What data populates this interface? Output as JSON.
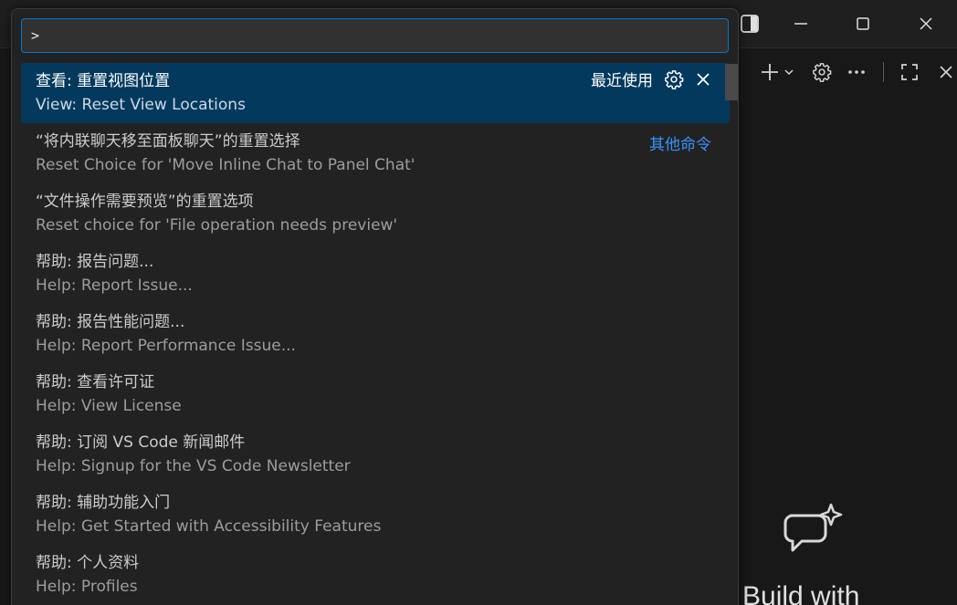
{
  "palette": {
    "input_value": ">",
    "items": [
      {
        "label": "查看: 重置视图位置",
        "detail": "View: Reset View Locations",
        "badge": "最近使用",
        "selected": true
      },
      {
        "label": "“将内联聊天移至面板聊天”的重置选择",
        "detail": "Reset Choice for 'Move Inline Chat to Panel Chat'",
        "group_label": "其他命令"
      },
      {
        "label": "“文件操作需要预览”的重置选项",
        "detail": "Reset choice for 'File operation needs preview'"
      },
      {
        "label": "帮助: 报告问题...",
        "detail": "Help: Report Issue..."
      },
      {
        "label": "帮助: 报告性能问题...",
        "detail": "Help: Report Performance Issue..."
      },
      {
        "label": "帮助: 查看许可证",
        "detail": "Help: View License"
      },
      {
        "label": "帮助: 订阅 VS Code 新闻邮件",
        "detail": "Help: Signup for the VS Code Newsletter"
      },
      {
        "label": "帮助: 辅助功能入门",
        "detail": "Help: Get Started with Accessibility Features"
      },
      {
        "label": "帮助: 个人资料",
        "detail": "Help: Profiles"
      }
    ]
  },
  "chat": {
    "welcome_title": "Build with"
  },
  "icons": {
    "settings": "gear-icon",
    "close": "close-icon",
    "add": "plus-icon",
    "more": "ellipsis-icon",
    "maximize": "maximize-icon",
    "chat": "chat-sparkle-icon"
  },
  "colors": {
    "selection_bg": "#04395e",
    "focus_border": "#0078d4",
    "link": "#3794ff"
  }
}
